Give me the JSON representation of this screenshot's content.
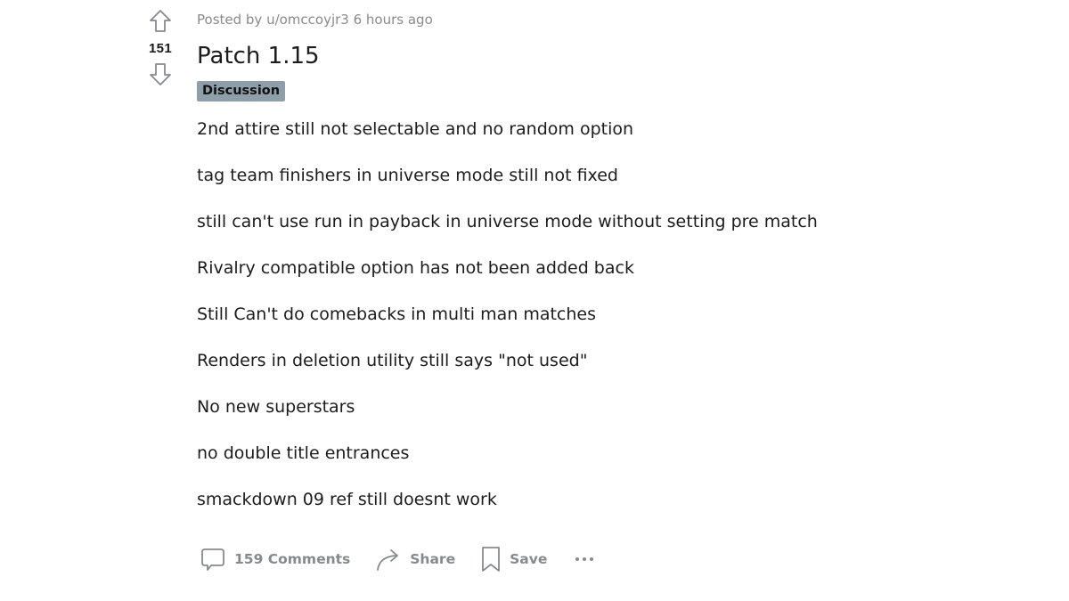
{
  "vote": {
    "score": "151",
    "upvote_icon": "arrow-up-outline-icon",
    "downvote_icon": "arrow-down-outline-icon"
  },
  "post": {
    "meta": "Posted by u/omccoyjr3 6 hours ago",
    "title": "Patch 1.15",
    "flair": "Discussion",
    "flair_color": "#8f9fa9",
    "body_lines": [
      "2nd attire still not selectable and no random option",
      "tag team finishers in universe mode still not fixed",
      "still can't use run in payback in universe mode without setting pre match",
      "Rivalry compatible option has not been added back",
      "Still Can't do comebacks in multi man matches",
      "Renders in deletion utility still says \"not used\"",
      "No new superstars",
      "no double title entrances",
      "smackdown 09 ref still doesnt work"
    ]
  },
  "actions": {
    "comments_label": "159 Comments",
    "comments_icon": "comment-bubble-icon",
    "share_label": "Share",
    "share_icon": "share-arrow-icon",
    "save_label": "Save",
    "save_icon": "bookmark-icon",
    "more_icon": "more-dots-icon"
  }
}
